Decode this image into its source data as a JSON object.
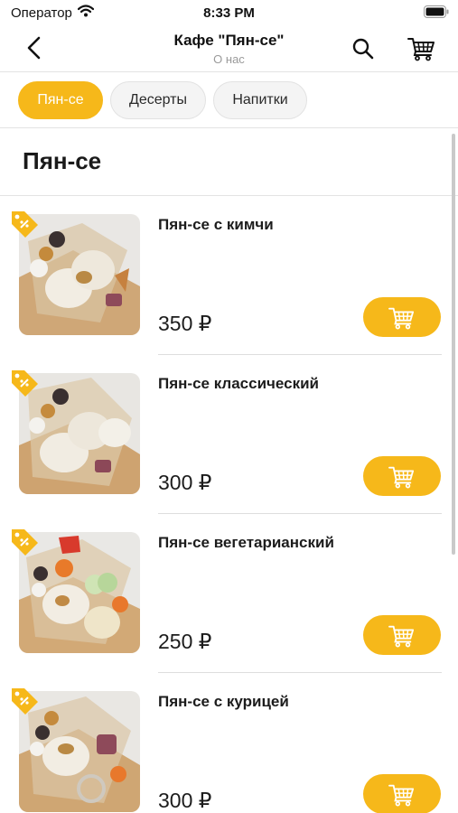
{
  "status_bar": {
    "carrier": "Оператор",
    "time": "8:33 PM"
  },
  "nav": {
    "title": "Кафе \"Пян-се\"",
    "subtitle": "О нас"
  },
  "categories": [
    {
      "label": "Пян-се",
      "active": true
    },
    {
      "label": "Десерты",
      "active": false
    },
    {
      "label": "Напитки",
      "active": false
    }
  ],
  "section": {
    "title": "Пян-се"
  },
  "products": [
    {
      "name": "Пян-се с кимчи",
      "price": "350 ₽"
    },
    {
      "name": "Пян-се классический",
      "price": "300 ₽"
    },
    {
      "name": "Пян-се вегетарианский",
      "price": "250 ₽"
    },
    {
      "name": "Пян-се с курицей",
      "price": "300 ₽"
    }
  ],
  "colors": {
    "accent": "#f6b81a",
    "divider": "#e3e3e3"
  },
  "icons": {
    "back": "chevron-left-icon",
    "search": "search-icon",
    "cart": "cart-icon",
    "discount": "discount-tag-icon",
    "add_to_cart": "cart-icon"
  }
}
